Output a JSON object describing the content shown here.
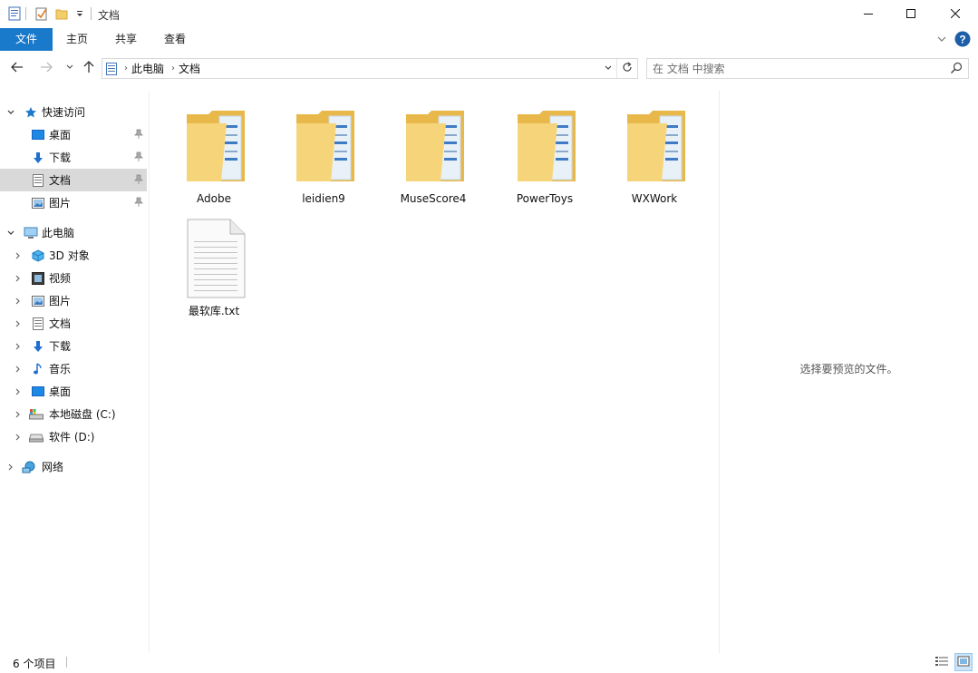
{
  "window": {
    "title": "文档",
    "minimize_icon": "minimize-icon",
    "maximize_icon": "maximize-icon",
    "close_icon": "close-icon"
  },
  "ribbon": {
    "tabs": [
      {
        "label": "文件",
        "active": true
      },
      {
        "label": "主页"
      },
      {
        "label": "共享"
      },
      {
        "label": "查看"
      }
    ]
  },
  "address": {
    "breadcrumb": [
      "此电脑",
      "文档"
    ]
  },
  "search": {
    "placeholder": "在 文档 中搜索"
  },
  "nav": {
    "quick_access": {
      "label": "快速访问",
      "items": [
        {
          "label": "桌面",
          "icon": "desktop-icon",
          "pinned": true
        },
        {
          "label": "下载",
          "icon": "download-icon",
          "pinned": true
        },
        {
          "label": "文档",
          "icon": "document-icon",
          "pinned": true,
          "selected": true
        },
        {
          "label": "图片",
          "icon": "picture-icon",
          "pinned": true
        }
      ]
    },
    "this_pc": {
      "label": "此电脑",
      "items": [
        {
          "label": "3D 对象",
          "icon": "3d-objects-icon"
        },
        {
          "label": "视频",
          "icon": "video-icon"
        },
        {
          "label": "图片",
          "icon": "picture-icon"
        },
        {
          "label": "文档",
          "icon": "document-icon"
        },
        {
          "label": "下载",
          "icon": "download-icon"
        },
        {
          "label": "音乐",
          "icon": "music-icon"
        },
        {
          "label": "桌面",
          "icon": "desktop-icon"
        },
        {
          "label": "本地磁盘 (C:)",
          "icon": "local-disk-icon"
        },
        {
          "label": "软件 (D:)",
          "icon": "drive-icon"
        }
      ]
    },
    "network": {
      "label": "网络",
      "icon": "network-icon"
    }
  },
  "files": [
    {
      "name": "Adobe",
      "type": "folder"
    },
    {
      "name": "leidien9",
      "type": "folder"
    },
    {
      "name": "MuseScore4",
      "type": "folder"
    },
    {
      "name": "PowerToys",
      "type": "folder"
    },
    {
      "name": "WXWork",
      "type": "folder"
    },
    {
      "name": "最软库.txt",
      "type": "text-file"
    }
  ],
  "preview": {
    "message": "选择要预览的文件。"
  },
  "status": {
    "item_count": "6 个项目"
  },
  "colors": {
    "accent": "#1979ca",
    "selected_bg": "#d9d9d9",
    "folder": "#f3cf6b"
  }
}
